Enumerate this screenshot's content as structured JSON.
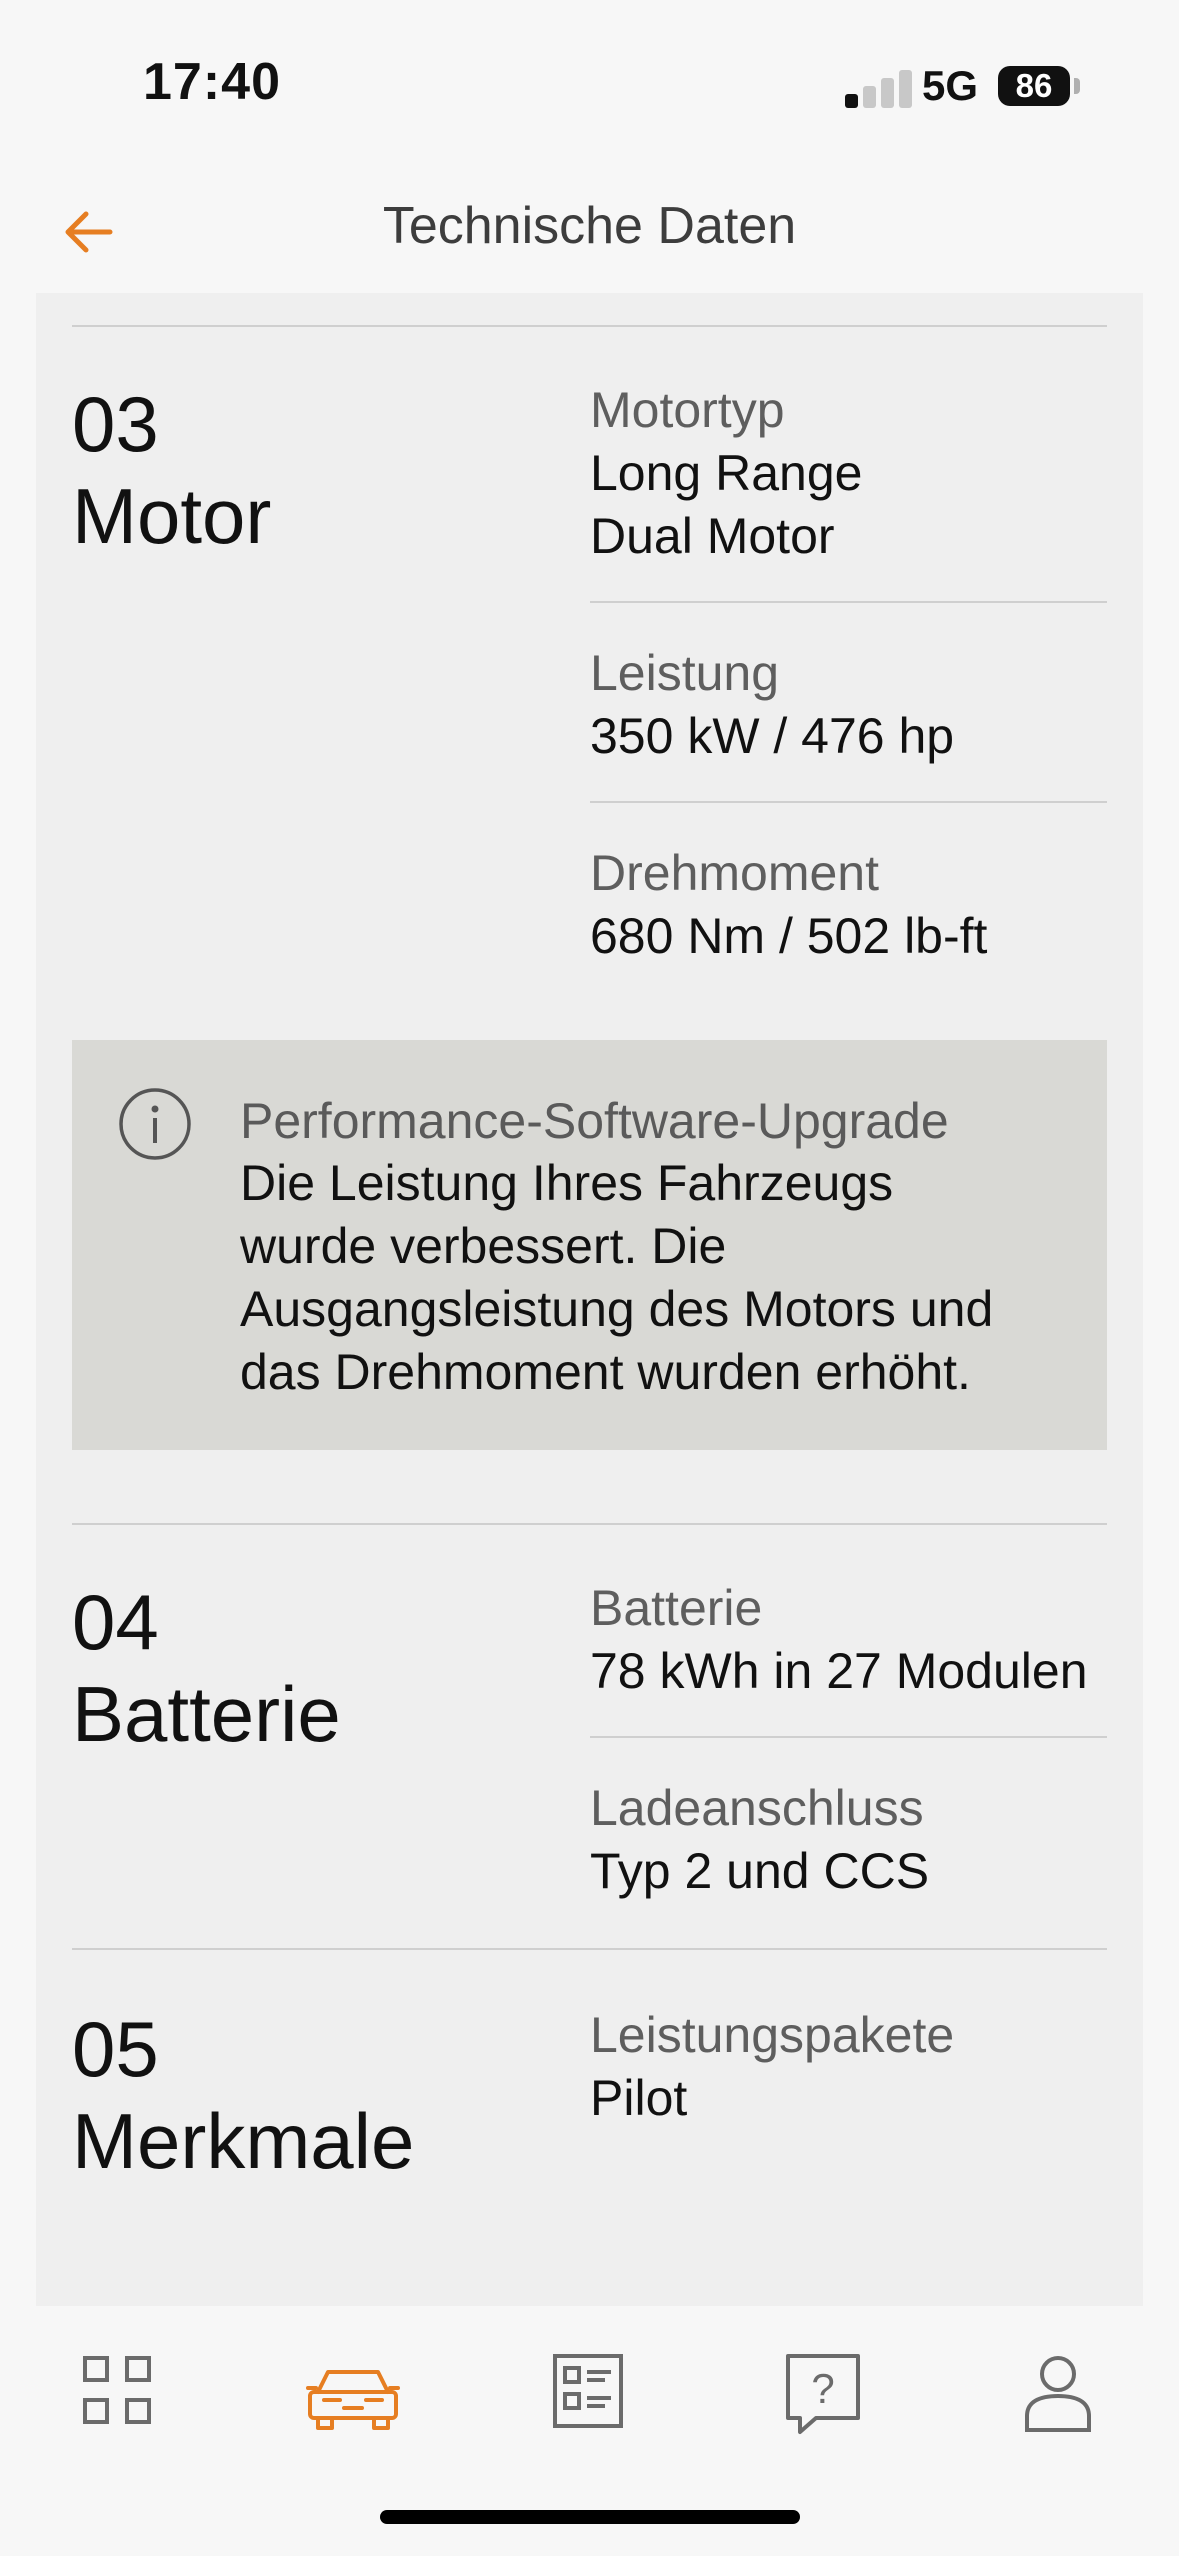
{
  "status_bar": {
    "time": "17:40",
    "network": "5G",
    "battery": "86"
  },
  "header": {
    "title": "Technische Daten",
    "back_icon": "arrow-left-icon"
  },
  "sections": {
    "motor": {
      "number": "03",
      "title": "Motor",
      "specs": [
        {
          "label": "Motortyp",
          "value_lines": [
            "Long Range",
            "Dual Motor"
          ]
        },
        {
          "label": "Leistung",
          "value": "350 kW / 476 hp"
        },
        {
          "label": "Drehmoment",
          "value": "680 Nm / 502 lb-ft"
        }
      ]
    },
    "batterie": {
      "number": "04",
      "title": "Batterie",
      "specs": [
        {
          "label": "Batterie",
          "value": "78 kWh in 27 Modulen"
        },
        {
          "label": "Ladeanschluss",
          "value": "Typ 2 und CCS"
        }
      ]
    },
    "merkmale": {
      "number": "05",
      "title": "Merkmale",
      "specs": [
        {
          "label": "Leistungspakete",
          "value": "Pilot"
        }
      ]
    }
  },
  "info_box": {
    "icon": "info-icon",
    "title": "Performance-Software-Upgrade",
    "body_lines": [
      "Die Leistung Ihres Fahrzeugs",
      "wurde verbessert. Die",
      "Ausgangsleistung des Motors und",
      "das Drehmoment wurden erhöht."
    ]
  },
  "bottom_nav": {
    "items": [
      {
        "icon": "grid-icon",
        "active": false
      },
      {
        "icon": "car-icon",
        "active": true
      },
      {
        "icon": "spec-list-icon",
        "active": false
      },
      {
        "icon": "help-icon",
        "active": false,
        "glyph": "?"
      },
      {
        "icon": "profile-icon",
        "active": false
      }
    ]
  },
  "colors": {
    "accent": "#e67e22",
    "panel": "#efefef",
    "info_box": "#d9d9d5",
    "text": "#111111",
    "muted": "#5e5e5e"
  }
}
